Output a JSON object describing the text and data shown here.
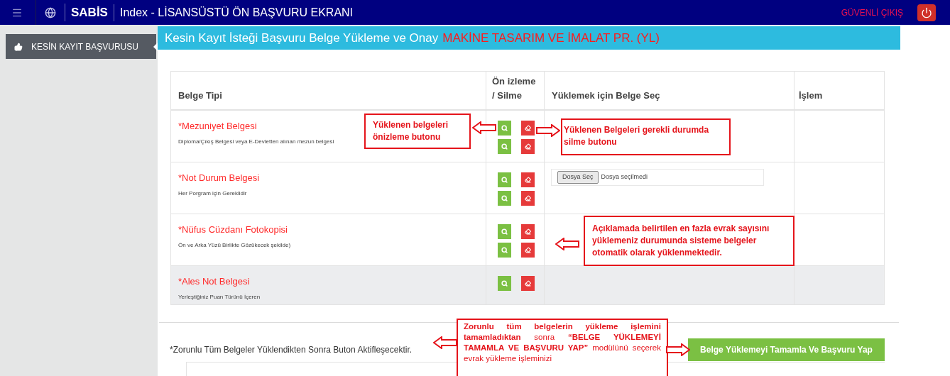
{
  "topbar": {
    "app_name": "SABİS",
    "title": "Index - LİSANSÜSTÜ ÖN BAŞVURU EKRANI",
    "logout": "GÜVENLİ ÇIKIŞ"
  },
  "sidebar": {
    "items": [
      {
        "label": "KESİN KAYIT BAŞVURUSU",
        "selected": true
      }
    ]
  },
  "page_header": {
    "title": "Kesin Kayıt İsteği Başvuru Belge Yükleme ve Onay",
    "program": "MAKİNE TASARIM VE İMALAT PR. (YL)"
  },
  "table": {
    "columns": [
      "Belge Tipi",
      "Ön izleme / Silme",
      "Yüklemek için Belge Seç",
      "İşlem"
    ],
    "rows": [
      {
        "name": "*Mezuniyet Belgesi",
        "description": "Diploma/Çıkış Belgesi veya E-Devletten alınan mezun belgesi",
        "highlighted": false,
        "files": [
          {
            "kind": "uploaded"
          },
          {
            "kind": "uploaded"
          }
        ]
      },
      {
        "name": "*Not Durum Belgesi",
        "description": "Her Porgram için Gereklidir",
        "highlighted": false,
        "files": [
          {
            "kind": "uploaded"
          },
          {
            "kind": "uploaded"
          }
        ],
        "file_input": {
          "button": "Dosya Seç",
          "status": "Dosya seçilmedi"
        }
      },
      {
        "name": "*Nüfus Cüzdanı Fotokopisi",
        "description": "Ön ve Arka Yüzü Birlikte Gözükecek şekilde)",
        "highlighted": false,
        "files": [
          {
            "kind": "uploaded"
          },
          {
            "kind": "uploaded"
          }
        ]
      },
      {
        "name": "*Ales Not Belgesi",
        "description": "Yerleştiğiniz Puan Türünü İçeren",
        "highlighted": true,
        "files": [
          {
            "kind": "uploaded"
          }
        ]
      }
    ]
  },
  "footer": {
    "note": "*Zorunlu Tüm Belgeler Yüklendikten Sonra Buton Aktifleşecektir.",
    "button": "Belge Yüklemeyi Tamamla Ve Başvuru Yap"
  },
  "annotations": [
    {
      "text": "Yüklenen belgeleri önizleme butonu"
    },
    {
      "text": "Yüklenen Belgeleri gerekli durumda silme butonu"
    },
    {
      "text": "Açıklamada belirtilen en fazla evrak sayısını yüklemeniz durumunda sisteme belgeler otomatik olarak yüklenmektedir."
    },
    {
      "text": "**Zorunlu tüm belgelerin yükleme işlemini tamamladıktan** sonra **“BELGE YÜKLEMEYİ TAMAMLA VE BAŞVURU YAP”** modülünü seçerek evrak yükleme işleminizi"
    }
  ]
}
